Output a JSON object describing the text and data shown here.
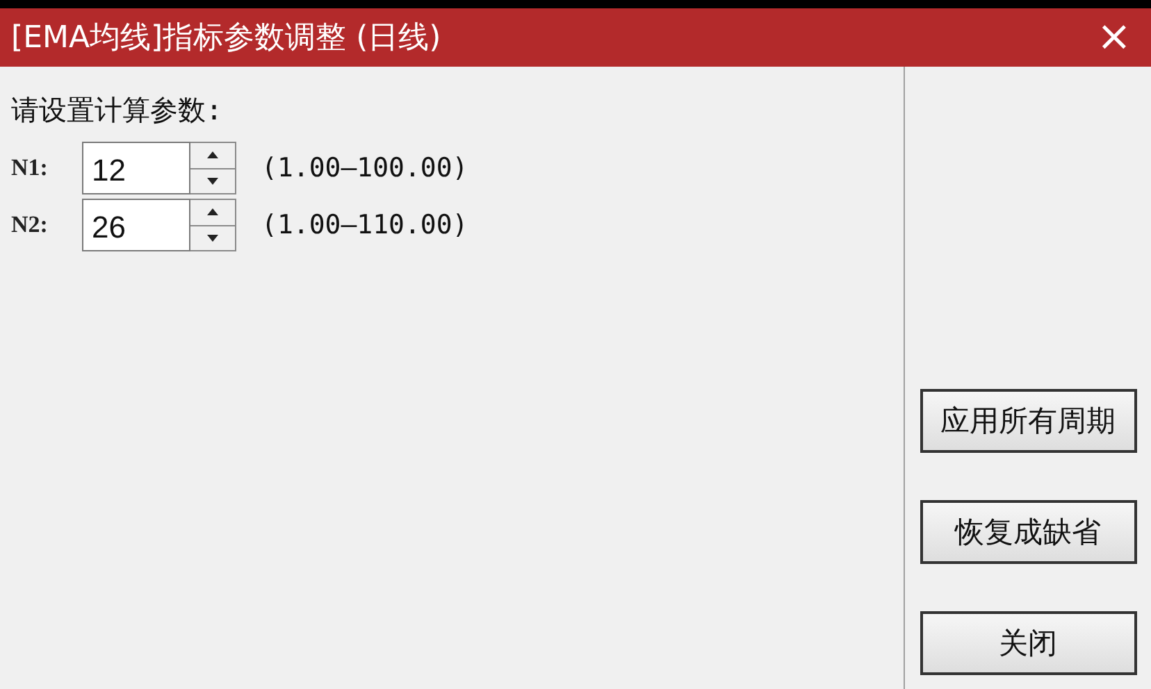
{
  "window": {
    "title": "[EMA均线]指标参数调整 (日线)",
    "close": "×"
  },
  "prompt": "请设置计算参数:",
  "params": [
    {
      "label": "N1:",
      "value": "12",
      "range": "(1.00—100.00)"
    },
    {
      "label": "N2:",
      "value": "26",
      "range": "(1.00—110.00)"
    }
  ],
  "buttons": [
    "应用所有周期",
    "恢复成缺省",
    "关闭"
  ]
}
